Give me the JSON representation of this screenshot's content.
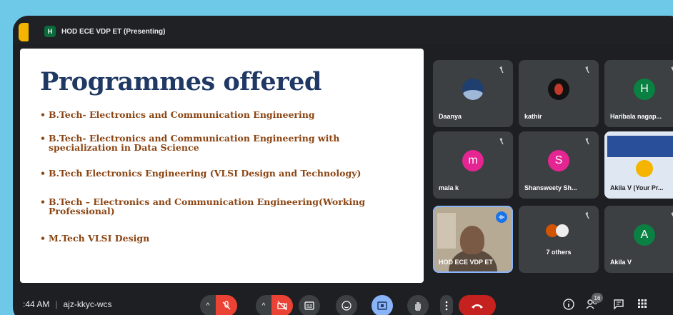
{
  "presenter": {
    "avatar_letter": "H",
    "label": "HOD ECE VDP ET (Presenting)"
  },
  "slide": {
    "title": "Programmes offered",
    "bullets": [
      {
        "line1": "B.Tech- Electronics and Communication Engineering",
        "line2": ""
      },
      {
        "line1": "B.Tech- Electronics and Communication Engineering with",
        "line2": "specialization in Data Science"
      },
      {
        "line1": "B.Tech Electronics Engineering (VLSI Design and Technology)",
        "line2": ""
      },
      {
        "line1": "B.Tech – Electronics and Communication Engineering(Working",
        "line2": "Professional)"
      },
      {
        "line1": "M.Tech VLSI Design",
        "line2": ""
      }
    ]
  },
  "participants": {
    "daanya": {
      "name": "Daanya"
    },
    "kathir": {
      "name": "kathir"
    },
    "haribala": {
      "name": "Haribala nagap...",
      "initial": "H",
      "color": "#0b8043"
    },
    "mala": {
      "name": "mala k",
      "initial": "m",
      "color": "#e52592"
    },
    "shansweety": {
      "name": "Shansweety Sh...",
      "initial": "S",
      "color": "#e52592"
    },
    "akila_pres": {
      "name": "Akila V (Your Pr..."
    },
    "self": {
      "name": "HOD ECE VDP ET"
    },
    "others": {
      "name": "7 others"
    },
    "akila": {
      "name": "Akila V",
      "initial": "A",
      "color": "#0b8043"
    }
  },
  "meeting": {
    "time": ":44 AM",
    "code": "ajz-kkyc-wcs",
    "people_count": "16"
  },
  "icons": [
    "mic-off-icon",
    "camera-off-icon",
    "captions-icon",
    "emoji-icon",
    "present-icon",
    "raise-hand-icon",
    "more-options-icon",
    "end-call-icon",
    "info-icon",
    "people-icon",
    "chat-icon",
    "activities-icon"
  ]
}
